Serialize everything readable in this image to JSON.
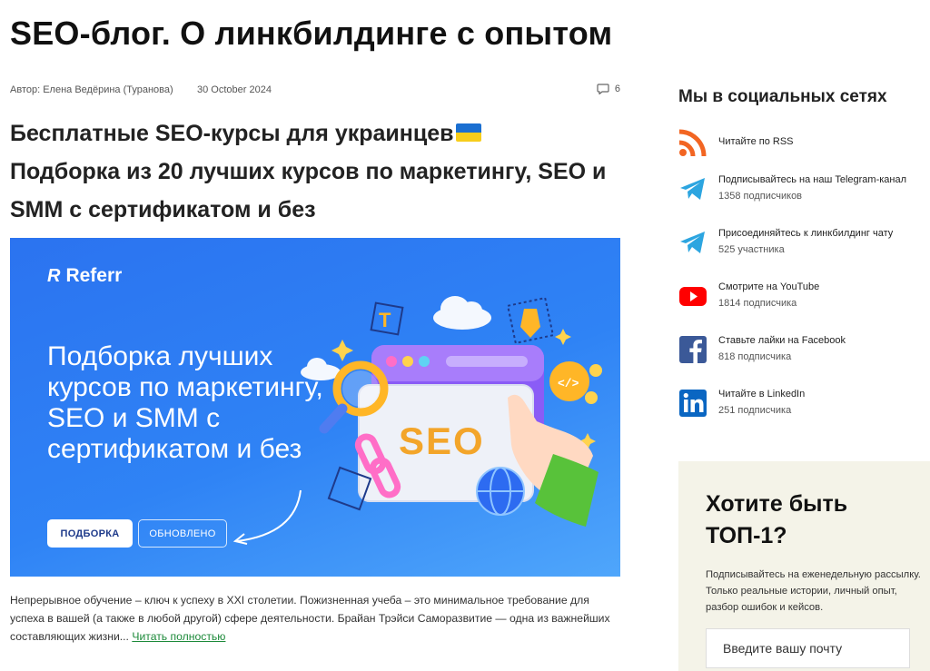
{
  "site": {
    "title": "SEO-блог. О линкбилдинге с опытом"
  },
  "post": {
    "author": "Автор: Елена Ведёрина (Туранова)",
    "date": "30 October 2024",
    "comments": "6",
    "title_line1": "Бесплатные SEO-курсы для украинцев",
    "title_rest": "Подборка из 20 лучших курсов по маркетингу, SEO и SMM с сертификатом и без",
    "banner": {
      "brand": "Referr",
      "headline": "Подборка лучших курсов по маркетингу, SEO и SMM с сертификатом и без",
      "badge_primary": "ПОДБОРКА",
      "badge_secondary": "ОБНОВЛЕНО",
      "seo_word": "SEO"
    },
    "excerpt": "Непрерывное обучение – ключ к успеху в XXI столетии. Пожизненная учеба – это минимальное требование для успеха в вашей (а также в любой другой) сфере деятельности. Брайан Трэйси Саморазвитие — одна из важнейших составляющих жизни... ",
    "read_more": "Читать полностью"
  },
  "sidebar": {
    "social_title": "Мы в социальных сетях",
    "social": [
      {
        "icon": "rss-icon",
        "label": "Читайте по RSS",
        "count": "",
        "color": "#f26522"
      },
      {
        "icon": "telegram-icon",
        "label": "Подписывайтесь на наш Telegram-канал",
        "count": "1358 подписчиков",
        "color": "#2ca5e0"
      },
      {
        "icon": "telegram-icon",
        "label": "Присоединяйтесь к линкбилдинг чату",
        "count": "525 участника",
        "color": "#2ca5e0"
      },
      {
        "icon": "youtube-icon",
        "label": "Смотрите на YouTube",
        "count": "1814 подписчика",
        "color": "#ff0000"
      },
      {
        "icon": "facebook-icon",
        "label": "Ставьте лайки на Facebook",
        "count": "818 подписчика",
        "color": "#3b5998"
      },
      {
        "icon": "linkedin-icon",
        "label": "Читайте в LinkedIn",
        "count": "251 подписчика",
        "color": "#0a66c2"
      }
    ],
    "promo": {
      "title": "Хотите быть ТОП-1?",
      "text": "Подписывайтесь на еженедельную рассылку. Только реальные истории, личный опыт, разбор ошибок и кейсов.",
      "email_placeholder": "Введите вашу почту"
    }
  },
  "colors": {
    "link": "#1d8a3a",
    "banner": "#2f83f5",
    "promo_bg": "#f4f3e8"
  }
}
